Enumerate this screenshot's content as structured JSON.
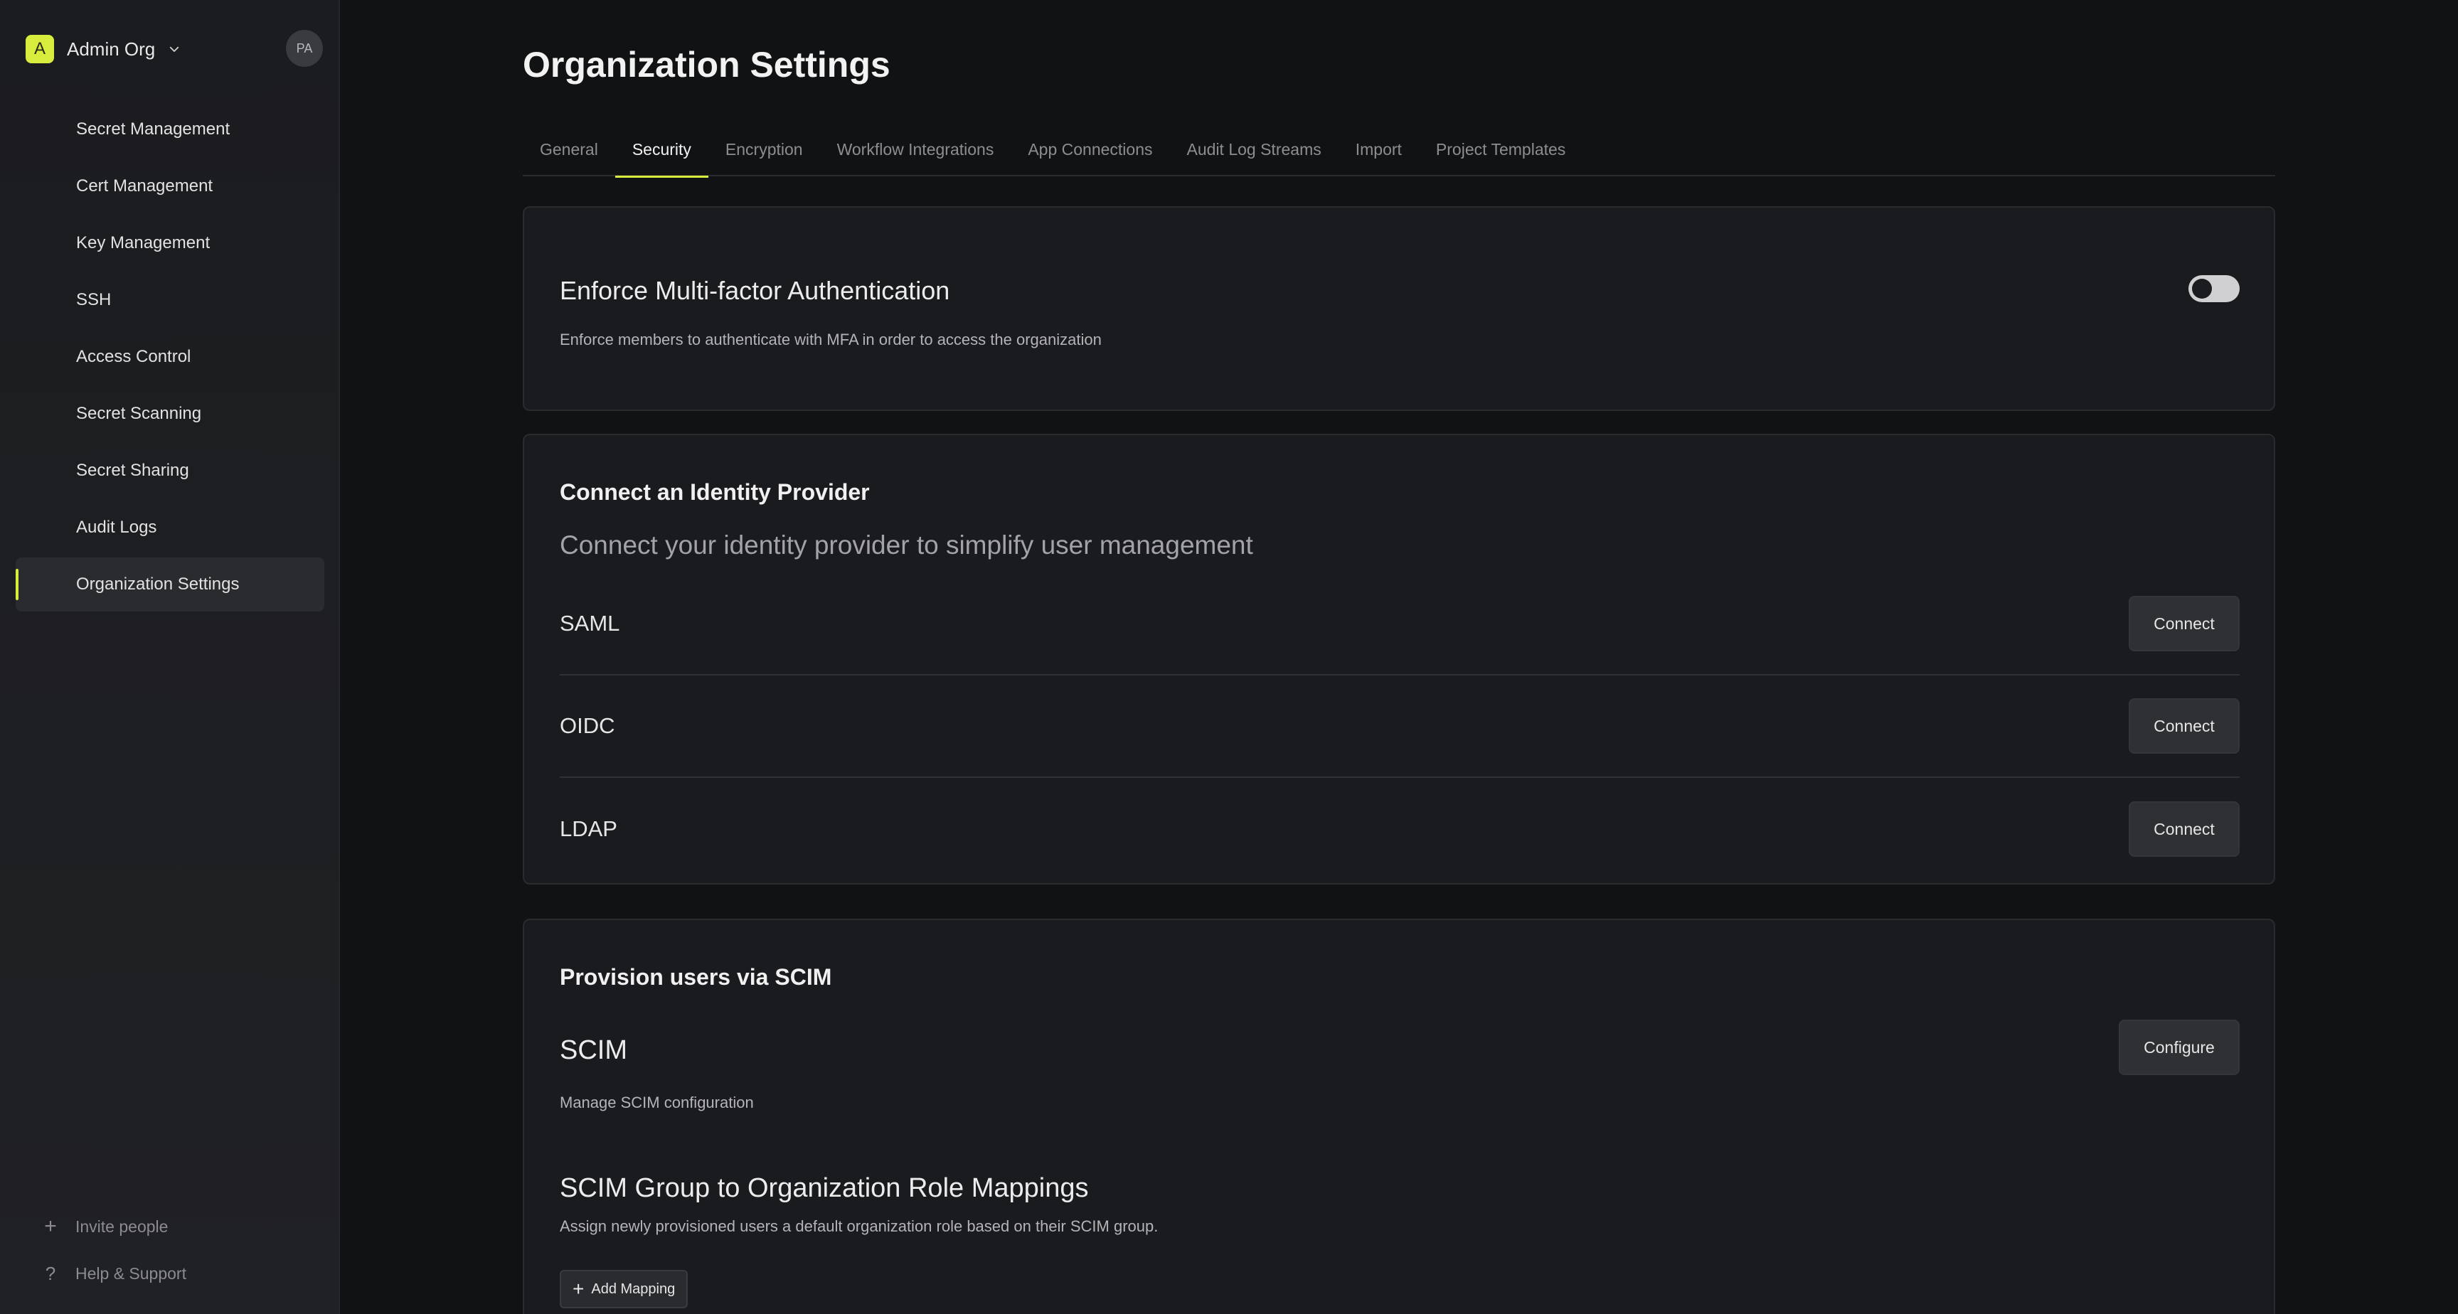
{
  "sidebar": {
    "org": {
      "logo_letter": "A",
      "name": "Admin Org"
    },
    "avatar_initials": "PA",
    "items": [
      {
        "label": "Secret Management"
      },
      {
        "label": "Cert Management"
      },
      {
        "label": "Key Management"
      },
      {
        "label": "SSH"
      },
      {
        "label": "Access Control"
      },
      {
        "label": "Secret Scanning"
      },
      {
        "label": "Secret Sharing"
      },
      {
        "label": "Audit Logs"
      },
      {
        "label": "Organization Settings",
        "active": true
      }
    ],
    "bottom": {
      "invite_label": "Invite people",
      "help_label": "Help & Support"
    }
  },
  "header": {
    "title": "Organization Settings"
  },
  "tabs": [
    {
      "label": "General"
    },
    {
      "label": "Security",
      "active": true
    },
    {
      "label": "Encryption"
    },
    {
      "label": "Workflow Integrations"
    },
    {
      "label": "App Connections"
    },
    {
      "label": "Audit Log Streams"
    },
    {
      "label": "Import"
    },
    {
      "label": "Project Templates"
    }
  ],
  "mfa": {
    "title": "Enforce Multi-factor Authentication",
    "description": "Enforce members to authenticate with MFA in order to access the organization",
    "enabled": false
  },
  "idp": {
    "title": "Connect an Identity Provider",
    "subtitle": "Connect your identity provider to simplify user management",
    "providers": [
      {
        "name": "SAML",
        "button": "Connect"
      },
      {
        "name": "OIDC",
        "button": "Connect"
      },
      {
        "name": "LDAP",
        "button": "Connect"
      }
    ]
  },
  "scim": {
    "title": "Provision users via SCIM",
    "name": "SCIM",
    "description": "Manage SCIM configuration",
    "configure_label": "Configure",
    "mapping_title": "SCIM Group to Organization Role Mappings",
    "mapping_description": "Assign newly provisioned users a default organization role based on their SCIM group.",
    "add_mapping_label": "Add Mapping"
  },
  "colors": {
    "accent": "#d8ec3e",
    "background": "#111214",
    "card": "#1a1b1e"
  }
}
